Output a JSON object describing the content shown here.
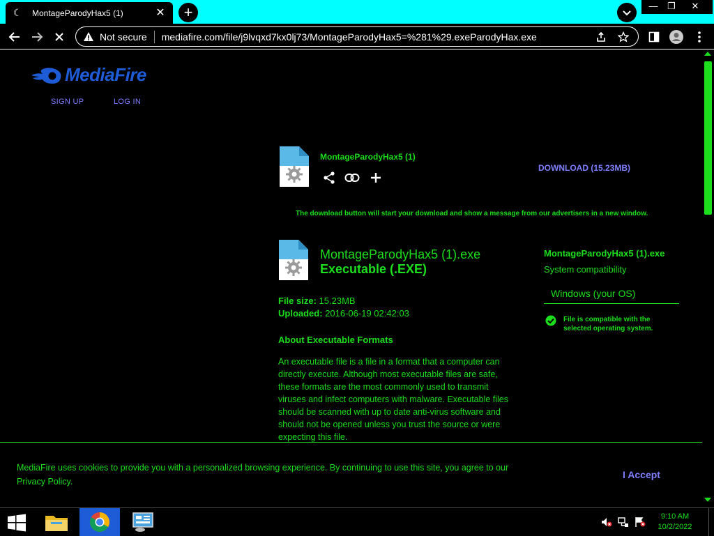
{
  "browser": {
    "tab_title": "MontageParodyHax5 (1)",
    "new_tab": "+",
    "tab_close": "✕",
    "not_secure": "Not secure",
    "url": "mediafire.com/file/j9lvqxd7kx0lj73/MontageParodyHax5=%281%29.exeParodyHax.exe",
    "window_controls": {
      "minimize": "—",
      "restore": "❐",
      "close": "✕"
    }
  },
  "site": {
    "logo_text": "MediaFire",
    "sign_up": "SIGN UP",
    "log_in": "LOG IN"
  },
  "file_header": {
    "name": "MontageParodyHax5 (1)",
    "download_label": "DOWNLOAD (15.23MB)",
    "download_note": "The download button will start your download and show a message from our advertisers in a new window."
  },
  "file_details": {
    "full_name": "MontageParodyHax5 (1).exe",
    "type": "Executable (.EXE)",
    "size_label": "File size:",
    "size_value": "15.23MB",
    "uploaded_label": "Uploaded:",
    "uploaded_value": "2016-06-19 02:42:03",
    "about_title": "About Executable Formats",
    "about_text": "An executable file is a file in a format that a computer can directly execute. Although most executable files are safe, these formats are the most commonly used to transmit viruses and infect computers with malware. Executable files should be scanned with up to date anti-virus software and should not be opened unless you trust the source or were expecting this file."
  },
  "sidebar": {
    "file_name": "MontageParodyHax5 (1).exe",
    "compat_title": "System compatibility",
    "os_select": "Windows (your OS)",
    "compat_note": "File is compatible with the selected operating system."
  },
  "cookie": {
    "text": "MediaFire uses cookies to provide you with a personalized browsing experience. By continuing to use this site, you agree to our Privacy Policy.",
    "accept": "I Accept"
  },
  "taskbar": {
    "time": "9:10 AM",
    "date": "10/2/2022"
  },
  "colors": {
    "accent_green": "#1cde1c",
    "link_purple": "#7f7fff",
    "brand_blue": "#1e5bd6",
    "tabbar_cyan": "#00ffff"
  },
  "icons": [
    "loading-favicon",
    "back-arrow-icon",
    "forward-arrow-icon",
    "stop-icon",
    "warning-icon",
    "share-page-icon",
    "star-icon",
    "sidebar-icon",
    "profile-icon",
    "menu-dots-icon",
    "file-gear-icon",
    "share-icon",
    "link-icon",
    "plus-icon",
    "check-circle-icon",
    "windows-start-icon",
    "file-explorer-icon",
    "chrome-icon",
    "control-panel-icon",
    "volume-icon",
    "network-icon",
    "flag-icon"
  ]
}
